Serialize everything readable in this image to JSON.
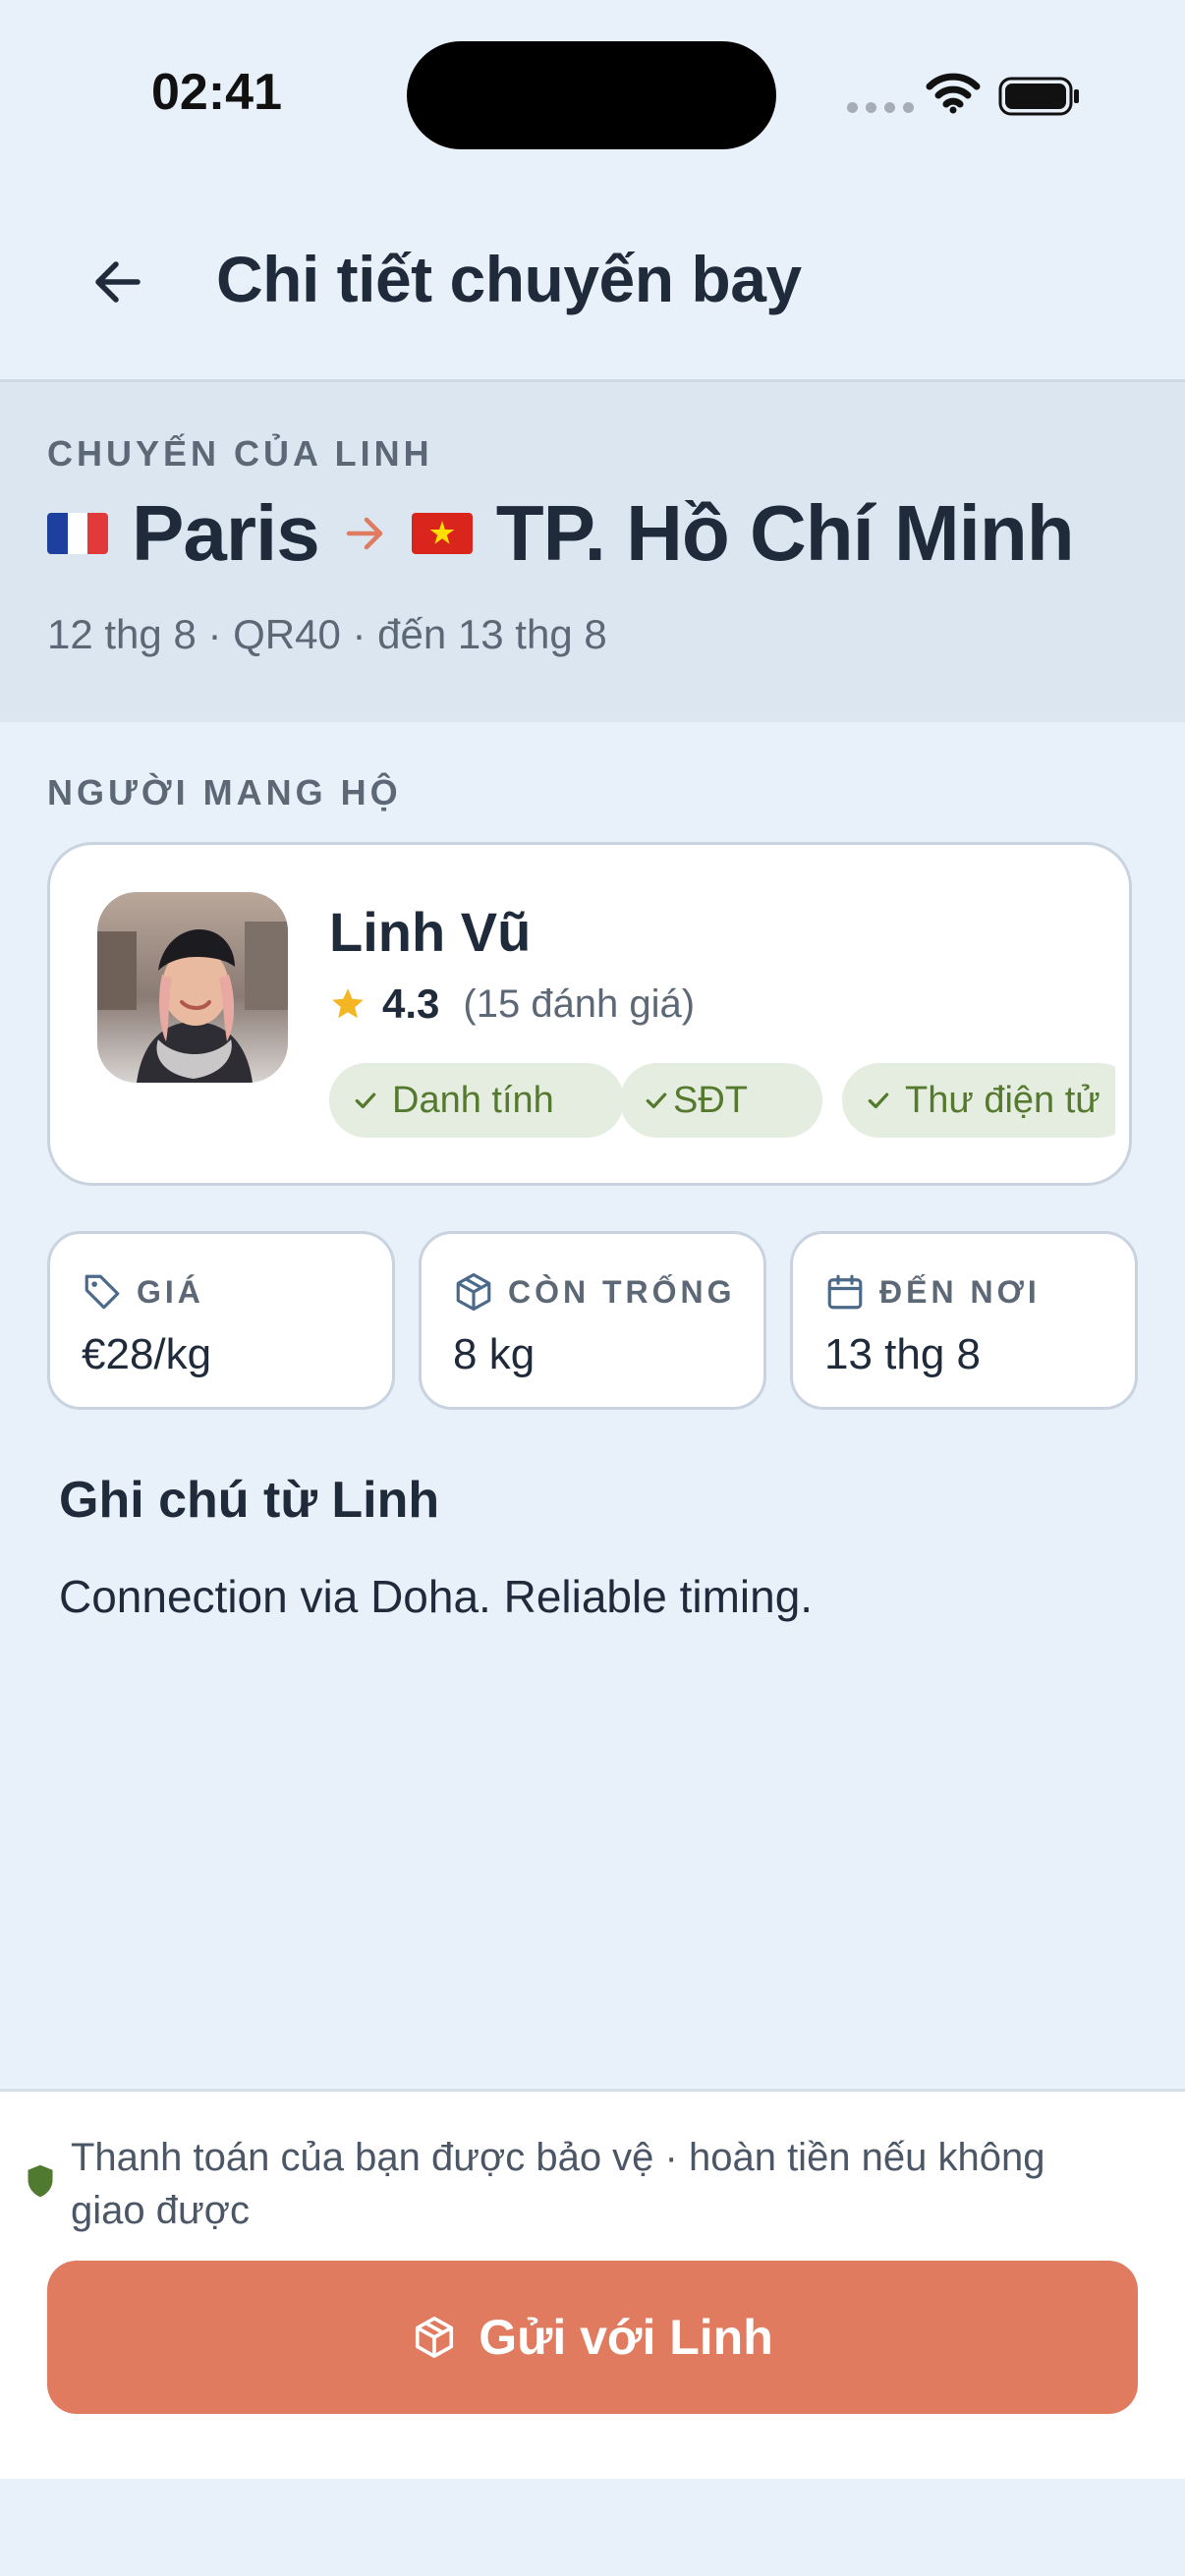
{
  "status_bar": {
    "time": "02:41"
  },
  "header": {
    "title": "Chi tiết chuyến bay",
    "back_icon": "arrow-left-icon"
  },
  "trip": {
    "label": "CHUYẾN CỦA LINH",
    "from_city": "Paris",
    "to_city": "TP. Hồ Chí Minh",
    "meta": "12 thg 8 · QR40 · đến 13 thg 8",
    "arrow_color": "#e07b5f"
  },
  "carrier_section": {
    "label": "NGƯỜI MANG HỘ"
  },
  "carrier": {
    "name": "Linh Vũ",
    "rating": "4.3",
    "reviews": "(15 đánh giá)",
    "badges": [
      "Danh tính",
      "SĐT",
      "Thư điện tử"
    ]
  },
  "stats": [
    {
      "icon": "tag-icon",
      "label": "GIÁ",
      "value": "€28/kg"
    },
    {
      "icon": "box-icon",
      "label": "CÒN TRỐNG",
      "value": "8 kg"
    },
    {
      "icon": "calendar-icon",
      "label": "ĐẾN NƠI",
      "value": "13 thg 8"
    }
  ],
  "note": {
    "title": "Ghi chú từ Linh",
    "text": "Connection via Doha. Reliable timing."
  },
  "footer": {
    "protection_text": "Thanh toán của bạn được bảo vệ · hoàn tiền nếu không giao được",
    "cta_label": "Gửi với Linh",
    "accent": "#e07b5f"
  }
}
